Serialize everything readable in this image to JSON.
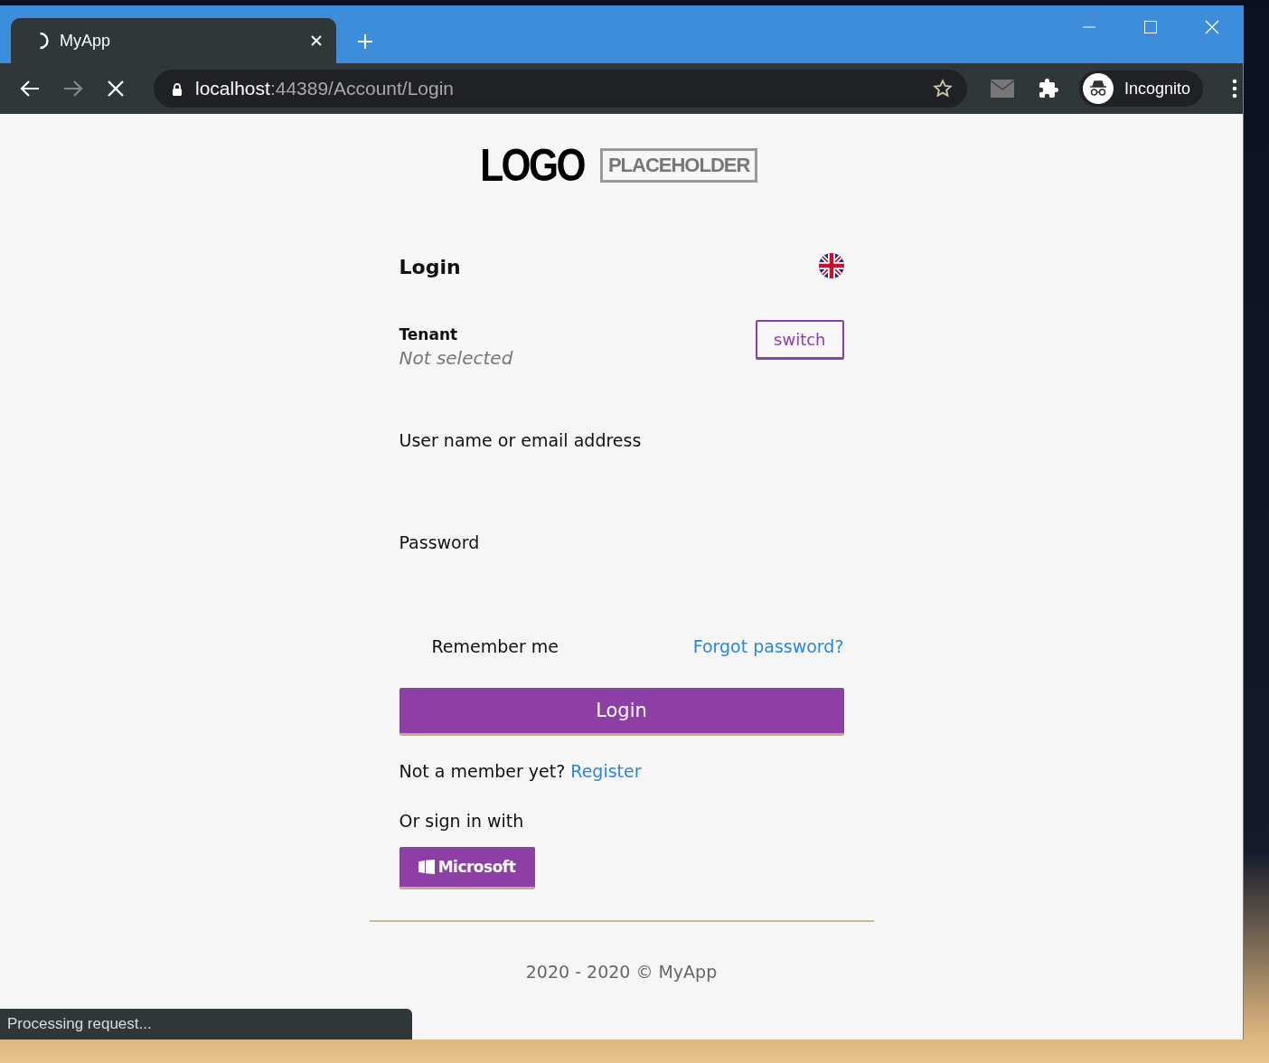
{
  "browser": {
    "tab": {
      "title": "MyApp",
      "loading": true
    },
    "address": {
      "host": "localhost",
      "path": ":44389/Account/Login"
    },
    "profile": "Incognito"
  },
  "page": {
    "logo": {
      "word": "LOGO",
      "tag": "PLACEHOLDER"
    },
    "heading": "Login",
    "tenant": {
      "label": "Tenant",
      "value": "Not selected",
      "button": "switch"
    },
    "fields": [
      {
        "label": "User name or email address"
      },
      {
        "label": "Password"
      }
    ],
    "remember_me": "Remember me",
    "forgot_link": "Forgot password?",
    "submit": "Login",
    "register": {
      "text": "Not a member yet?",
      "link": "Register"
    },
    "external_heading": "Or sign in with",
    "providers": [
      {
        "label": "Microsoft"
      }
    ],
    "footer": "2020 - 2020 © MyApp"
  },
  "status_bar": "Processing request..."
}
